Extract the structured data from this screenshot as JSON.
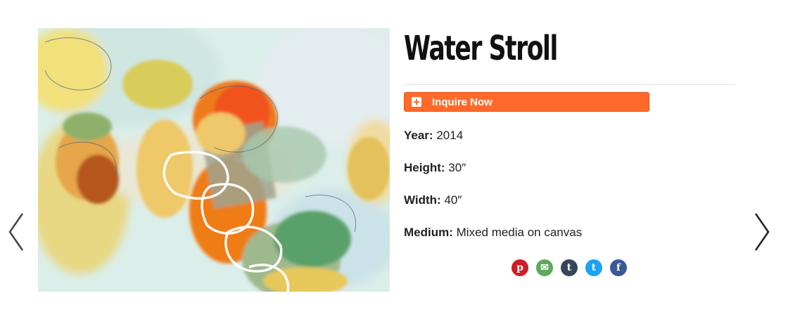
{
  "artwork": {
    "title": "Water Stroll",
    "year_label": "Year:",
    "year": "2014",
    "height_label": "Height:",
    "height": "30″",
    "width_label": "Width:",
    "width": "40″",
    "medium_label": "Medium:",
    "medium": "Mixed media on canvas"
  },
  "actions": {
    "inquire_label": "Inquire Now",
    "inquire_color": "#ff6a2a"
  },
  "share": [
    {
      "name": "pinterest-icon",
      "glyph": "p",
      "color": "#cb2027"
    },
    {
      "name": "email-icon",
      "glyph": "✉",
      "color": "#5fa85d"
    },
    {
      "name": "tumblr-icon",
      "glyph": "t",
      "color": "#35465c"
    },
    {
      "name": "twitter-icon",
      "glyph": "t",
      "color": "#1da1f2"
    },
    {
      "name": "facebook-icon",
      "glyph": "f",
      "color": "#3b5998"
    }
  ],
  "navigation": {
    "prev_icon": "chevron-left-icon",
    "next_icon": "chevron-right-icon"
  }
}
